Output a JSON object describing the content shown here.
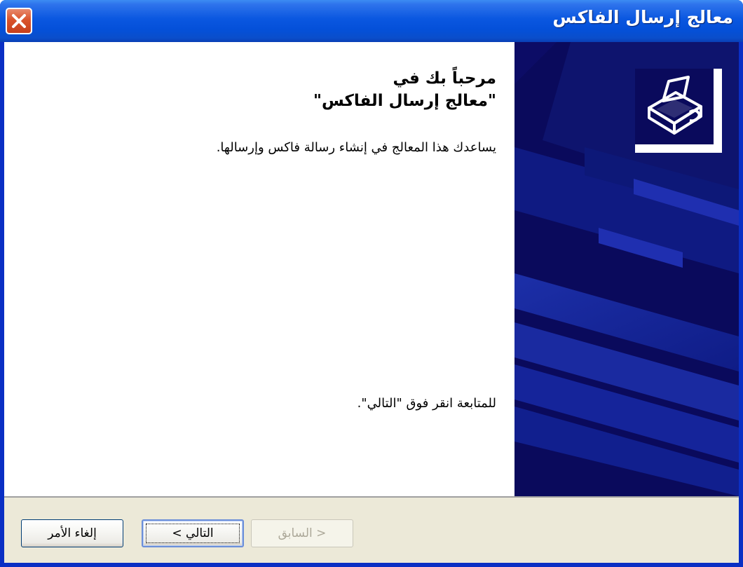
{
  "window": {
    "title": "معالج إرسال الفاكس",
    "close_icon": "close-icon"
  },
  "welcome": {
    "line1": "مرحباً بك في",
    "line2": "\"معالج إرسال الفاكس\""
  },
  "description": "يساعدك هذا المعالج في إنشاء رسالة فاكس وإرسالها.",
  "continue_hint": "للمتابعة انقر فوق \"التالي\".",
  "side_panel": {
    "icon": "fax-machine-icon"
  },
  "buttons": {
    "cancel_label": "إلغاء الأمر",
    "next_label": "التالي >",
    "back_label": "< السابق",
    "back_enabled": false
  },
  "colors": {
    "titlebar": "#0a57e0",
    "side_panel": "#0a0a5c",
    "close_button": "#d9532c",
    "button_bar": "#ece9d8"
  }
}
